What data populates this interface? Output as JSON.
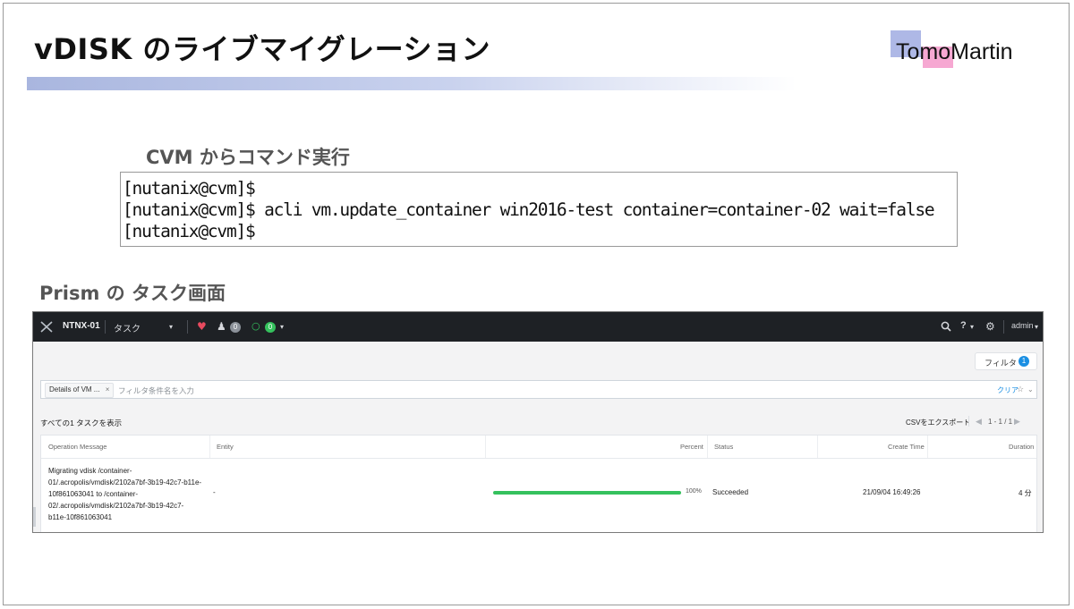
{
  "slide": {
    "title": "vDISK のライブマイグレーション",
    "logo_text": "TomoMartin",
    "section1_heading": "CVM からコマンド実行",
    "section2_heading": "Prism の タスク画面"
  },
  "terminal": {
    "lines": [
      "[nutanix@cvm]$",
      "[nutanix@cvm]$ acli vm.update_container win2016-test container=container-02 wait=false",
      "[nutanix@cvm]$"
    ]
  },
  "prism": {
    "topbar": {
      "cluster_name": "NTNX-01",
      "menu_label": "タスク",
      "alerts_count": "0",
      "tasks_count": "0",
      "help_label": "?",
      "user_label": "admin"
    },
    "filter_button": {
      "label": "フィルタ",
      "count": "1"
    },
    "filter_bar": {
      "chip_label": "Details of VM ...",
      "chip_close": "×",
      "placeholder": "フィルタ条件名を入力",
      "clear_label": "クリア"
    },
    "list_summary": "すべての1 タスクを表示",
    "export_label": "CSVをエクスポート",
    "pagination": "1 - 1 / 1",
    "columns": [
      "Operation Message",
      "Entity",
      "Percent",
      "Status",
      "Create Time",
      "Duration"
    ],
    "rows": [
      {
        "operation_message": "Migrating vdisk /container-\n01/.acropolis/vmdisk/2102a7bf-3b19-42c7-b11e-\n10f861063041 to /container-\n02/.acropolis/vmdisk/2102a7bf-3b19-42c7-\nb11e-10f861063041",
        "entity": "-",
        "percent_label": "100%",
        "percent_value": 100,
        "status": "Succeeded",
        "create_time": "21/09/04 16:49:26",
        "duration": "4 分"
      }
    ],
    "colors": {
      "topbar": "#1e2125",
      "progress": "#35c15d",
      "heart": "#e84a5f",
      "accent": "#1a8fe3"
    }
  }
}
